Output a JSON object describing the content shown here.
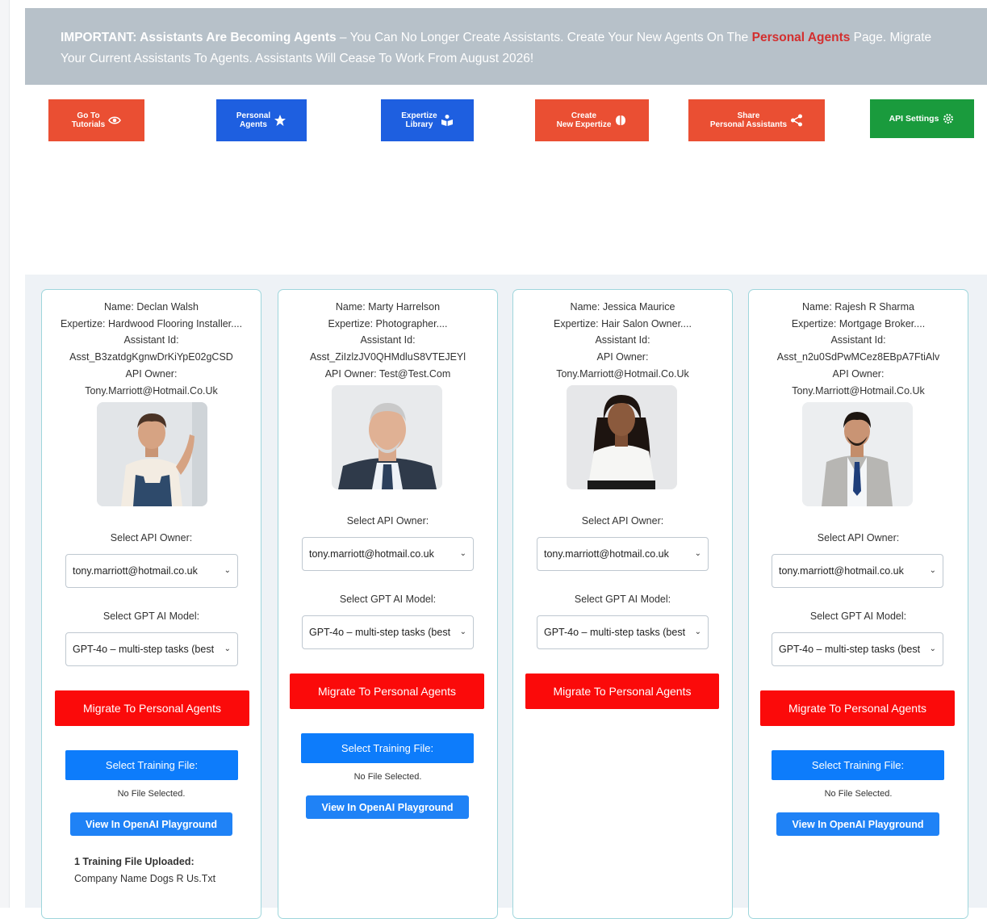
{
  "banner": {
    "bold": "IMPORTANT: Assistants Are Becoming Agents",
    "text1": " – You Can No Longer Create Assistants. Create Your New Agents On The ",
    "highlight": "Personal Agents",
    "text2": " Page. Migrate Your Current Assistants To Agents. Assistants Will Cease To Work From August 2026!"
  },
  "toolbar": {
    "tutorials": [
      "Go To",
      "Tutorials"
    ],
    "agents": [
      "Personal",
      "Agents"
    ],
    "library": [
      "Expertize",
      "Library"
    ],
    "create": [
      "Create",
      "New Expertize"
    ],
    "share": [
      "Share",
      "Personal Assistants"
    ],
    "api": "API Settings"
  },
  "labels": {
    "select_owner": "Select API Owner:",
    "select_model": "Select GPT AI Model:",
    "migrate": "Migrate To Personal Agents",
    "training": "Select Training File:",
    "no_file": "No File Selected.",
    "playground": "View In OpenAI Playground",
    "owner_value": "tony.marriott@hotmail.co.uk",
    "model_value": "GPT-4o – multi-step tasks (best"
  },
  "cards": [
    {
      "name": "Name: Declan Walsh",
      "expertize": "Expertize: Hardwood Flooring Installer....",
      "id_label": "Assistant Id:",
      "id": "Asst_B3zatdgKgnwDrKiYpE02gCSD",
      "owner_label": "API Owner:",
      "owner": "Tony.Marriott@Hotmail.Co.Uk",
      "uploaded_title": "1 Training File Uploaded:",
      "uploaded_file": "Company Name Dogs R Us.Txt"
    },
    {
      "name": "Name: Marty Harrelson",
      "expertize": "Expertize: Photographer....",
      "id_label": "Assistant Id:",
      "id": "Asst_ZiIzlzJV0QHMdluS8VTEJEYl",
      "owner_line": "API Owner: Test@Test.Com"
    },
    {
      "name": "Name: Jessica Maurice",
      "expertize": "Expertize: Hair Salon Owner....",
      "id_label": "Assistant Id:",
      "owner_label": "API Owner:",
      "owner": "Tony.Marriott@Hotmail.Co.Uk"
    },
    {
      "name": "Name: Rajesh R Sharma",
      "expertize": "Expertize: Mortgage Broker....",
      "id_label": "Assistant Id:",
      "id": "Asst_n2u0SdPwMCez8EBpA7FtiAlv",
      "owner_label": "API Owner:",
      "owner": "Tony.Marriott@Hotmail.Co.Uk"
    }
  ]
}
